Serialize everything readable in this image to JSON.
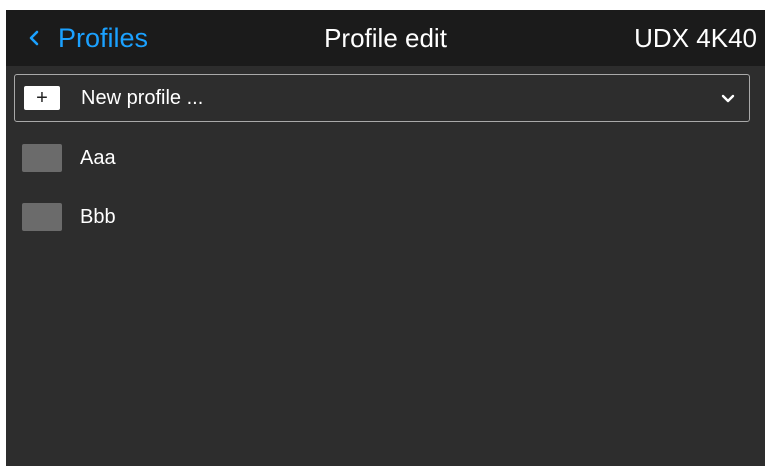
{
  "header": {
    "back_label": "Profiles",
    "back_icon": "chevron-left-icon",
    "title": "Profile edit",
    "device": "UDX 4K40"
  },
  "new_profile": {
    "plus_symbol": "+",
    "label": "New profile ...",
    "dropdown_icon": "chevron-down-icon"
  },
  "profiles": [
    {
      "label": "Aaa"
    },
    {
      "label": "Bbb"
    }
  ],
  "colors": {
    "accent": "#1ba1ff",
    "header_bg": "#1b1b1b",
    "screen_bg": "#2d2d2d",
    "swatch": "#6b6b6b"
  }
}
